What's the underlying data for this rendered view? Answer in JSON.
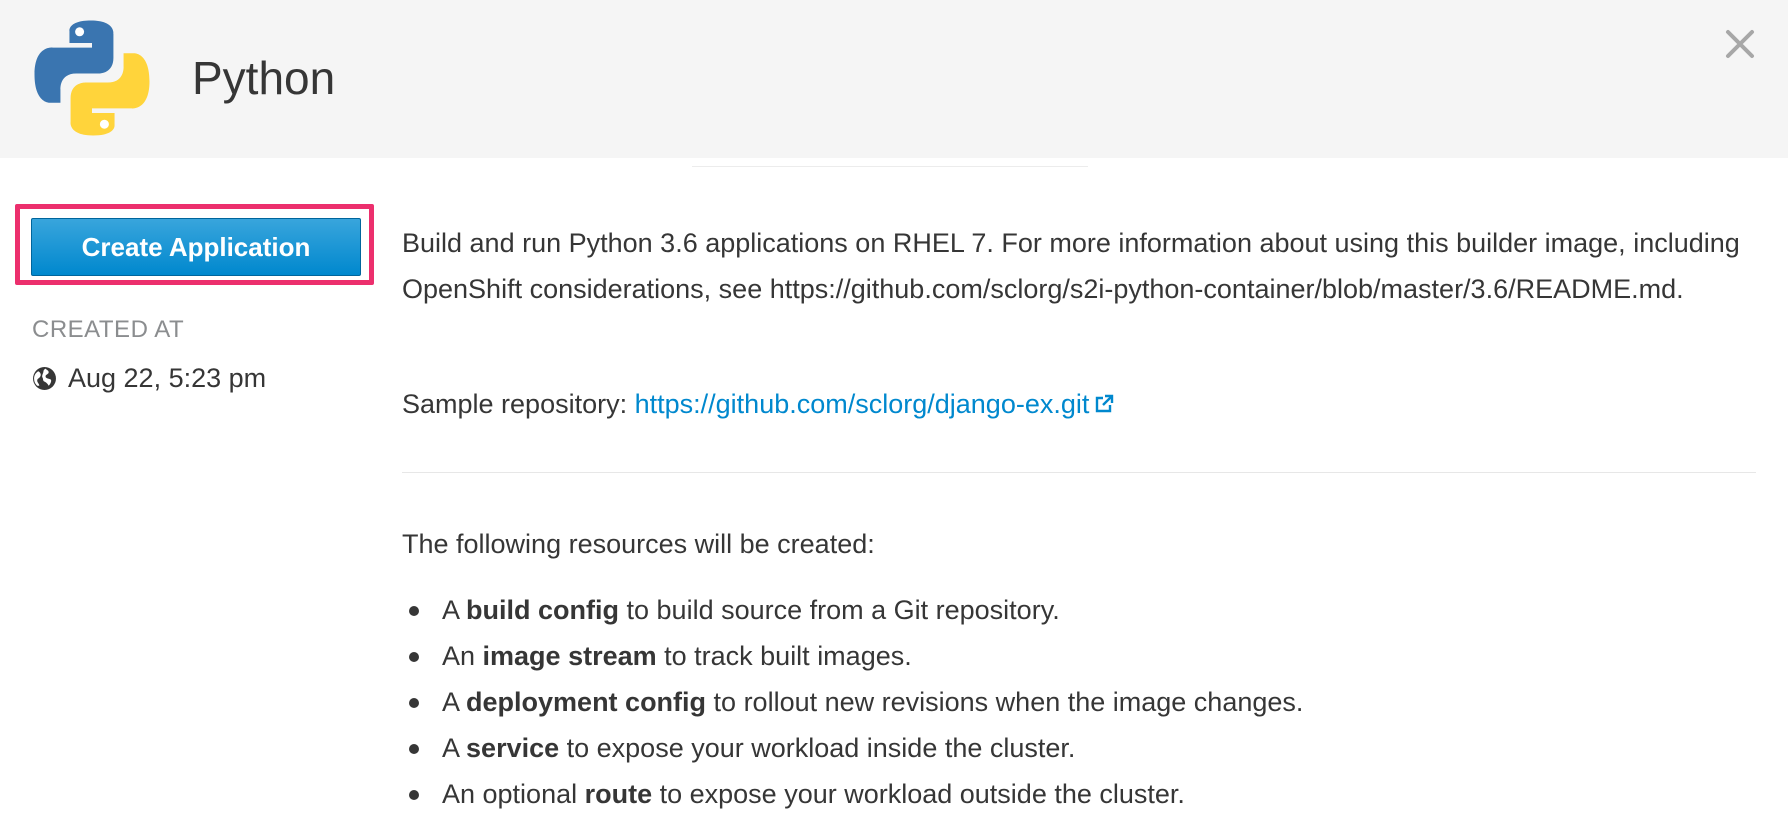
{
  "header": {
    "title": "Python",
    "logo_icon": "python-logo",
    "close_icon": "close-icon"
  },
  "sidebar": {
    "create_button_label": "Create Application",
    "created_at_label": "CREATED AT",
    "created_at_value": "Aug 22, 5:23 pm",
    "created_icon": "globe-icon"
  },
  "main": {
    "description": "Build and run Python 3.6 applications on RHEL 7. For more information about using this builder image, including OpenShift considerations, see https://github.com/sclorg/s2i-python-container/blob/master/3.6/README.md.",
    "sample_label": "Sample repository:",
    "sample_link": "https://github.com/sclorg/django-ex.git",
    "resources_intro": "The following resources will be created:",
    "resources": [
      {
        "pre": "A ",
        "bold": "build config",
        "post": " to build source from a Git repository."
      },
      {
        "pre": "An ",
        "bold": "image stream",
        "post": " to track built images."
      },
      {
        "pre": "A ",
        "bold": "deployment config",
        "post": " to rollout new revisions when the image changes."
      },
      {
        "pre": "A ",
        "bold": "service",
        "post": " to expose your workload inside the cluster."
      },
      {
        "pre": "An optional ",
        "bold": "route",
        "post": " to expose your workload outside the cluster."
      }
    ]
  },
  "colors": {
    "accent": "#0088ce",
    "highlight": "#ec2f6d",
    "header_bg": "#f5f5f5"
  }
}
